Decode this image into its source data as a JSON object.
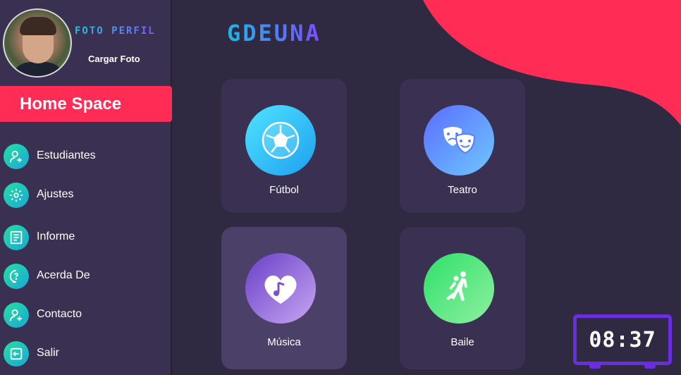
{
  "profile": {
    "title": "FOTO PERFIL",
    "upload_label": "Cargar Foto"
  },
  "sidebar": {
    "home_label": "Home Space",
    "items": [
      {
        "label": "Estudiantes",
        "icon": "add-user-icon"
      },
      {
        "label": "Ajustes",
        "icon": "gear-icon"
      },
      {
        "label": "Informe",
        "icon": "document-icon"
      },
      {
        "label": "Acerda De",
        "icon": "question-bubble-icon"
      },
      {
        "label": "Contacto",
        "icon": "add-user-icon"
      },
      {
        "label": "Salir",
        "icon": "exit-icon"
      }
    ]
  },
  "header": {
    "logo": "GDEUNA"
  },
  "cards": [
    {
      "label": "Fútbol",
      "icon": "soccer-ball-icon"
    },
    {
      "label": "Teatro",
      "icon": "theater-masks-icon"
    },
    {
      "label": "Música",
      "icon": "music-heart-icon"
    },
    {
      "label": "Baile",
      "icon": "dancing-couple-icon"
    }
  ],
  "clock": {
    "time": "08:37"
  },
  "colors": {
    "accent": "#ff2d55",
    "clock_border": "#6b2de0"
  }
}
